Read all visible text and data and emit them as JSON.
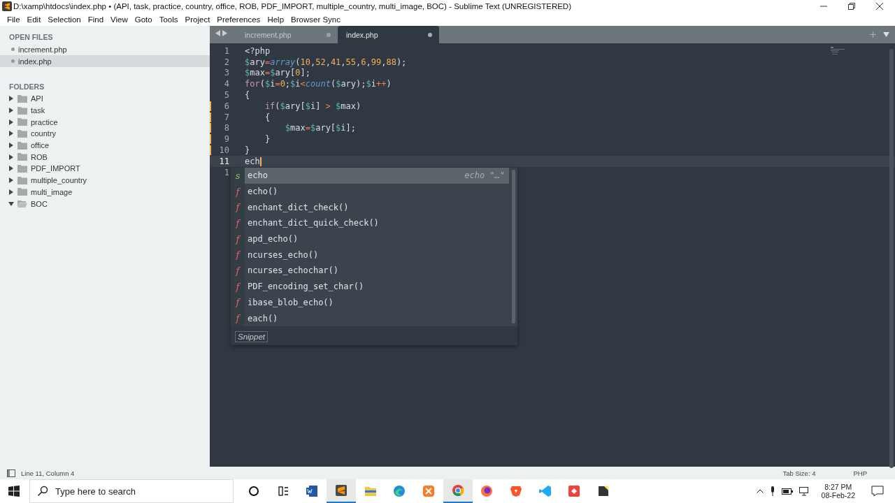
{
  "window": {
    "title": "D:\\xamp\\htdocs\\index.php • (API, task, practice, country, office, ROB, PDF_IMPORT, multiple_country, multi_image, BOC) - Sublime Text (UNREGISTERED)"
  },
  "menu": [
    "File",
    "Edit",
    "Selection",
    "Find",
    "View",
    "Goto",
    "Tools",
    "Project",
    "Preferences",
    "Help",
    "Browser Sync"
  ],
  "sidebar": {
    "open_files_heading": "OPEN FILES",
    "open_files": [
      {
        "name": "increment.php",
        "selected": false
      },
      {
        "name": "index.php",
        "selected": true
      }
    ],
    "folders_heading": "FOLDERS",
    "folders": [
      {
        "name": "API",
        "expanded": false
      },
      {
        "name": "task",
        "expanded": false
      },
      {
        "name": "practice",
        "expanded": false
      },
      {
        "name": "country",
        "expanded": false
      },
      {
        "name": "office",
        "expanded": false
      },
      {
        "name": "ROB",
        "expanded": false
      },
      {
        "name": "PDF_IMPORT",
        "expanded": false
      },
      {
        "name": "multiple_country",
        "expanded": false
      },
      {
        "name": "multi_image",
        "expanded": false
      },
      {
        "name": "BOC",
        "expanded": true
      }
    ]
  },
  "tabs": [
    {
      "label": "increment.php",
      "selected": false
    },
    {
      "label": "index.php",
      "selected": true
    }
  ],
  "code": [
    {
      "number": "1",
      "modified": false,
      "current": false,
      "tokens": [
        {
          "t": "<?php",
          "kind": "plain"
        }
      ]
    },
    {
      "number": "2",
      "modified": false,
      "current": false,
      "tokens": [
        {
          "t": "$",
          "kind": "sigil"
        },
        {
          "t": "ary",
          "kind": "plain"
        },
        {
          "t": "=",
          "kind": "op"
        },
        {
          "t": "array",
          "kind": "fn"
        },
        {
          "t": "(",
          "kind": "plain"
        },
        {
          "t": "10",
          "kind": "num"
        },
        {
          "t": ",",
          "kind": "plain"
        },
        {
          "t": "52",
          "kind": "num"
        },
        {
          "t": ",",
          "kind": "plain"
        },
        {
          "t": "41",
          "kind": "num"
        },
        {
          "t": ",",
          "kind": "plain"
        },
        {
          "t": "55",
          "kind": "num"
        },
        {
          "t": ",",
          "kind": "plain"
        },
        {
          "t": "6",
          "kind": "num"
        },
        {
          "t": ",",
          "kind": "plain"
        },
        {
          "t": "99",
          "kind": "num"
        },
        {
          "t": ",",
          "kind": "plain"
        },
        {
          "t": "88",
          "kind": "num"
        },
        {
          "t": ");",
          "kind": "plain"
        }
      ]
    },
    {
      "number": "3",
      "modified": false,
      "current": false,
      "tokens": [
        {
          "t": "$",
          "kind": "sigil"
        },
        {
          "t": "max",
          "kind": "plain"
        },
        {
          "t": "=",
          "kind": "op"
        },
        {
          "t": "$",
          "kind": "sigil"
        },
        {
          "t": "ary[",
          "kind": "plain"
        },
        {
          "t": "0",
          "kind": "num"
        },
        {
          "t": "];",
          "kind": "plain"
        }
      ]
    },
    {
      "number": "4",
      "modified": false,
      "current": false,
      "tokens": [
        {
          "t": "for",
          "kind": "kw"
        },
        {
          "t": "(",
          "kind": "plain"
        },
        {
          "t": "$",
          "kind": "sigil"
        },
        {
          "t": "i",
          "kind": "plain"
        },
        {
          "t": "=",
          "kind": "op"
        },
        {
          "t": "0",
          "kind": "num"
        },
        {
          "t": ";",
          "kind": "plain"
        },
        {
          "t": "$",
          "kind": "sigil"
        },
        {
          "t": "i",
          "kind": "plain"
        },
        {
          "t": "<",
          "kind": "op"
        },
        {
          "t": "count",
          "kind": "fn"
        },
        {
          "t": "(",
          "kind": "plain"
        },
        {
          "t": "$",
          "kind": "sigil"
        },
        {
          "t": "ary);",
          "kind": "plain"
        },
        {
          "t": "$",
          "kind": "sigil"
        },
        {
          "t": "i",
          "kind": "plain"
        },
        {
          "t": "++",
          "kind": "op"
        },
        {
          "t": ")",
          "kind": "plain"
        }
      ]
    },
    {
      "number": "5",
      "modified": false,
      "current": false,
      "tokens": [
        {
          "t": "{",
          "kind": "plain"
        }
      ]
    },
    {
      "number": "6",
      "modified": true,
      "current": false,
      "tokens": [
        {
          "t": "    if",
          "kind": "kw"
        },
        {
          "t": "(",
          "kind": "plain"
        },
        {
          "t": "$",
          "kind": "sigil"
        },
        {
          "t": "ary[",
          "kind": "plain"
        },
        {
          "t": "$",
          "kind": "sigil"
        },
        {
          "t": "i] ",
          "kind": "plain"
        },
        {
          "t": ">",
          "kind": "op"
        },
        {
          "t": " $",
          "kind": "sigil"
        },
        {
          "t": "max)",
          "kind": "plain"
        }
      ]
    },
    {
      "number": "7",
      "modified": true,
      "current": false,
      "tokens": [
        {
          "t": "    {",
          "kind": "plain"
        }
      ]
    },
    {
      "number": "8",
      "modified": true,
      "current": false,
      "tokens": [
        {
          "t": "        $",
          "kind": "sigil"
        },
        {
          "t": "max",
          "kind": "plain"
        },
        {
          "t": "=",
          "kind": "op"
        },
        {
          "t": "$",
          "kind": "sigil"
        },
        {
          "t": "ary[",
          "kind": "plain"
        },
        {
          "t": "$",
          "kind": "sigil"
        },
        {
          "t": "i];",
          "kind": "plain"
        }
      ]
    },
    {
      "number": "9",
      "modified": true,
      "current": false,
      "tokens": [
        {
          "t": "    }",
          "kind": "plain"
        }
      ]
    },
    {
      "number": "10",
      "modified": true,
      "current": false,
      "tokens": [
        {
          "t": "}",
          "kind": "plain"
        }
      ]
    },
    {
      "number": "11",
      "modified": false,
      "current": true,
      "tokens": [
        {
          "t": "ech",
          "kind": "plain"
        }
      ]
    },
    {
      "number": "1",
      "modified": false,
      "current": false
    }
  ],
  "autocomplete": {
    "items": [
      {
        "kind": "snippet",
        "badge": "s",
        "label": "echo",
        "hint": "echo \"…\"",
        "selected": true
      },
      {
        "kind": "function",
        "badge": "f",
        "label": "echo()",
        "selected": false
      },
      {
        "kind": "function",
        "badge": "f",
        "label": "enchant_dict_check()",
        "selected": false
      },
      {
        "kind": "function",
        "badge": "f",
        "label": "enchant_dict_quick_check()",
        "selected": false
      },
      {
        "kind": "function",
        "badge": "f",
        "label": "apd_echo()",
        "selected": false
      },
      {
        "kind": "function",
        "badge": "f",
        "label": "ncurses_echo()",
        "selected": false
      },
      {
        "kind": "function",
        "badge": "f",
        "label": "ncurses_echochar()",
        "selected": false
      },
      {
        "kind": "function",
        "badge": "f",
        "label": "PDF_encoding_set_char()",
        "selected": false
      },
      {
        "kind": "function",
        "badge": "f",
        "label": "ibase_blob_echo()",
        "selected": false
      },
      {
        "kind": "function",
        "badge": "f",
        "label": "each()",
        "selected": false
      }
    ],
    "footer": "Snippet"
  },
  "status_bar": {
    "position": "Line 11, Column 4",
    "tab_size": "Tab Size: 4",
    "syntax": "PHP"
  },
  "taskbar": {
    "search_placeholder": "Type here to search",
    "apps": [
      {
        "kind": "cortana",
        "active": false
      },
      {
        "kind": "taskview",
        "active": false
      },
      {
        "kind": "word",
        "active": false
      },
      {
        "kind": "sublime",
        "active": true
      },
      {
        "kind": "files",
        "active": false
      },
      {
        "kind": "edge",
        "active": false
      },
      {
        "kind": "xampp",
        "active": false
      },
      {
        "kind": "chrome",
        "active": true
      },
      {
        "kind": "firefox",
        "active": false
      },
      {
        "kind": "brave",
        "active": false
      },
      {
        "kind": "vscode",
        "active": false
      },
      {
        "kind": "anydesk",
        "active": false
      },
      {
        "kind": "notes",
        "active": false
      }
    ],
    "time": "8:27 PM",
    "date": "08-Feb-22"
  }
}
